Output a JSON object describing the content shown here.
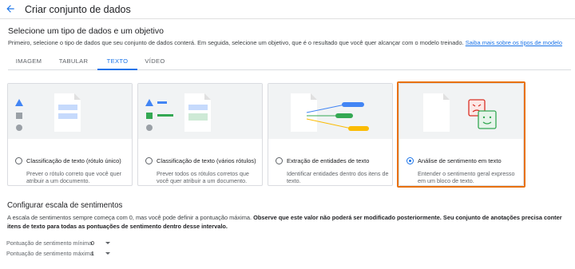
{
  "header": {
    "title": "Criar conjunto de dados",
    "back_icon": "arrow-back-icon"
  },
  "data_type_section": {
    "title": "Selecione um tipo de dados e um objetivo",
    "description": "Primeiro, selecione o tipo de dados que seu conjunto de dados conterá. Em seguida, selecione um objetivo, que é o resultado que você quer alcançar com o modelo treinado.",
    "link_text": "Saiba mais sobre os tipos de modelo"
  },
  "tabs": [
    {
      "label": "IMAGEM",
      "active": false
    },
    {
      "label": "TABULAR",
      "active": false
    },
    {
      "label": "TEXTO",
      "active": true
    },
    {
      "label": "VÍDEO",
      "active": false
    }
  ],
  "objective_cards": [
    {
      "title": "Classificação de texto (rótulo único)",
      "description": "Prever o rótulo correto que você quer atribuir a um documento.",
      "selected": false
    },
    {
      "title": "Classificação de texto (vários rótulos)",
      "description": "Prever todos os rótulos corretos que você quer atribuir a um documento.",
      "selected": false
    },
    {
      "title": "Extração de entidades de texto",
      "description": "Identificar entidades dentro dos itens de texto.",
      "selected": false
    },
    {
      "title": "Análise de sentimento em texto",
      "description": "Entender o sentimento geral expresso em um bloco de texto.",
      "selected": true
    }
  ],
  "sentiment_config": {
    "title": "Configurar escala de sentimentos",
    "description_normal": "A escala de sentimentos sempre começa com 0, mas você pode definir a pontuação máxima. ",
    "description_bold": "Observe que este valor não poderá ser modificado posteriormente. Seu conjunto de anotações precisa conter itens de texto para todas as pontuações de sentimento dentro desse intervalo.",
    "min_label": "Pontuação de sentimento mínima",
    "min_value": "0",
    "max_label": "Pontuação de sentimento máxima",
    "max_value": "1"
  },
  "colors": {
    "accent": "#1a73e8",
    "highlight": "#e8710a",
    "sad_face": "#d93025",
    "happy_face": "#34a853",
    "entity_blue": "#4285f4",
    "entity_green": "#34a853",
    "entity_yellow": "#fbbc04"
  }
}
